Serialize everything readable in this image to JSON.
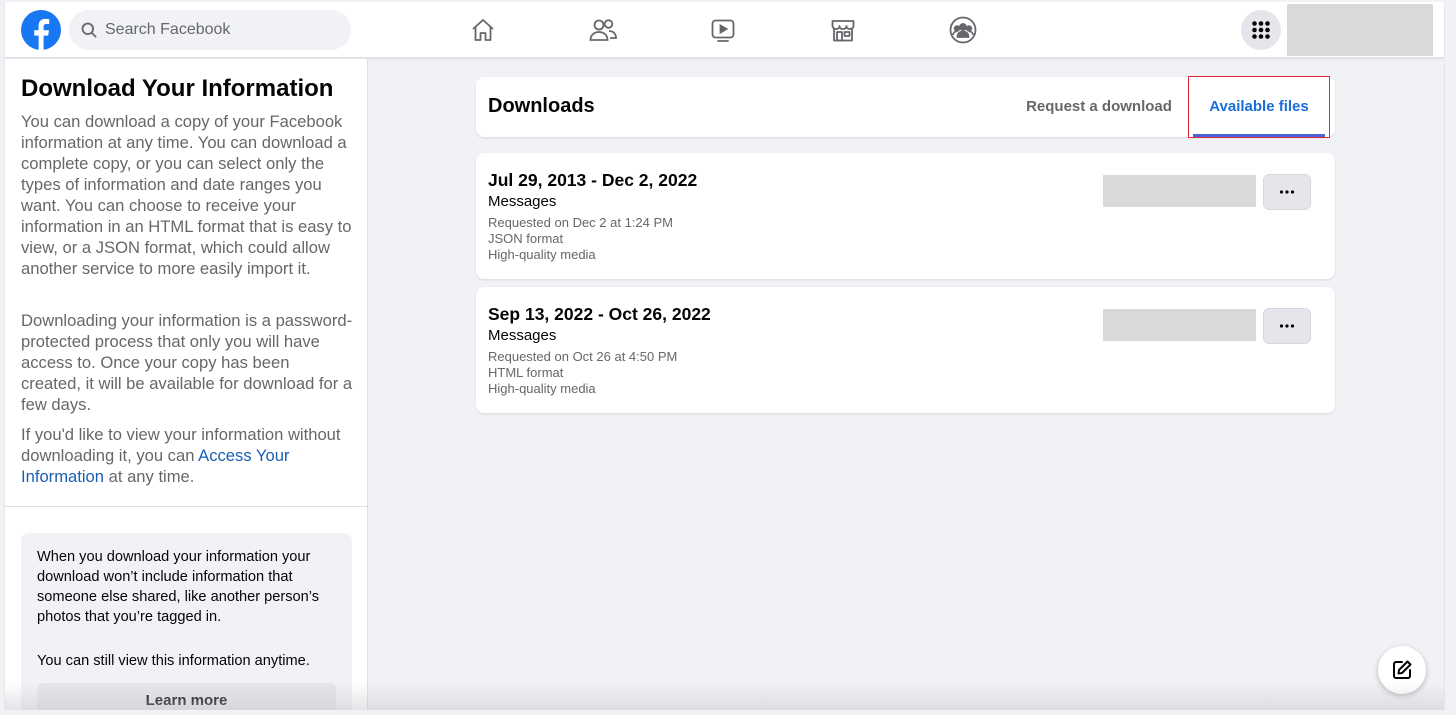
{
  "topbar": {
    "search_placeholder": "Search Facebook",
    "brand_color": "#1877f2",
    "nav_icons": [
      "home-icon",
      "friends-icon",
      "watch-icon",
      "marketplace-icon",
      "groups-icon"
    ],
    "menu_icon": "grid-menu-icon"
  },
  "left_panel": {
    "title": "Download Your Information",
    "para1": "You can download a copy of your Facebook information at any time. You can download a complete copy, or you can select only the types of information and date ranges you want. You can choose to receive your information in an HTML format that is easy to view, or a JSON format, which could allow another service to more easily import it.",
    "para2": "Downloading your information is a password-protected process that only you will have access to. Once your copy has been created, it will be available for download for a few days.",
    "para3_prefix": "If you'd like to view your information without downloading it, you can ",
    "para3_link": "Access Your Information",
    "para3_suffix": " at any time.",
    "notice_text1": "When you download your information your download won’t include information that someone else shared, like another person’s photos that you’re tagged in.",
    "notice_text2": "You can still view this information anytime.",
    "learn_more_label": "Learn more"
  },
  "downloads": {
    "title": "Downloads",
    "tabs": [
      {
        "label": "Request a download",
        "active": false
      },
      {
        "label": "Available files",
        "active": true
      }
    ],
    "files": [
      {
        "range": "Jul 29, 2013 - Dec 2, 2022",
        "type": "Messages",
        "requested": "Requested on Dec 2 at 1:24 PM",
        "format": "JSON format",
        "media": "High-quality media"
      },
      {
        "range": "Sep 13, 2022 - Oct 26, 2022",
        "type": "Messages",
        "requested": "Requested on Oct 26 at 4:50 PM",
        "format": "HTML format",
        "media": "High-quality media"
      }
    ],
    "more_label": "···"
  },
  "colors": {
    "accent": "#1a6ed8",
    "highlight_box": "#e0283a",
    "tab_underline": "#4a66d6",
    "link": "#1a5fb4"
  },
  "compose_icon": "compose-icon"
}
